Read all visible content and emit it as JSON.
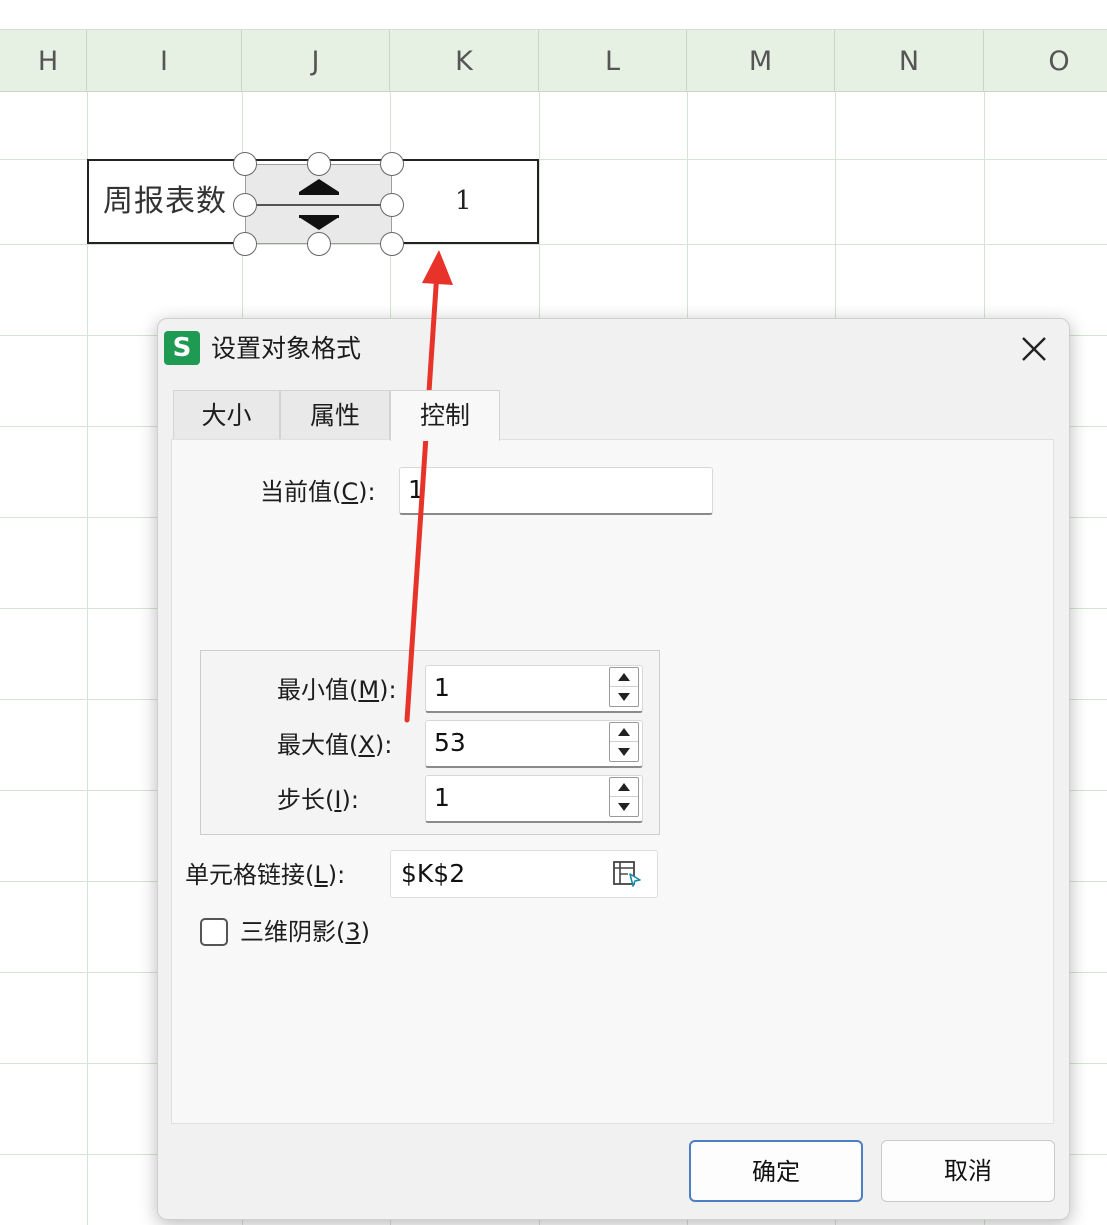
{
  "sheet": {
    "columns": [
      "H",
      "I",
      "J",
      "K",
      "L",
      "M",
      "N",
      "O"
    ],
    "label_cell": "周报表数",
    "value_cell": "1"
  },
  "dialog": {
    "app_icon": "S",
    "title": "设置对象格式",
    "tabs": [
      "大小",
      "属性",
      "控制"
    ],
    "active_tab": "控制",
    "current_value": {
      "label_pre": "当前值(",
      "key": "C",
      "label_post": "):",
      "value": "1"
    },
    "min_value": {
      "label_pre": "最小值(",
      "key": "M",
      "label_post": "):",
      "value": "1"
    },
    "max_value": {
      "label_pre": "最大值(",
      "key": "X",
      "label_post": "):",
      "value": "53"
    },
    "step": {
      "label_pre": "步长(",
      "key": "I",
      "label_post": "):",
      "value": "1"
    },
    "cell_link": {
      "label_pre": "单元格链接(",
      "key": "L",
      "label_post": "):",
      "value": "$K$2"
    },
    "shadow_3d": {
      "label_pre": "三维阴影(",
      "key": "3",
      "label_post": ")",
      "checked": false
    },
    "ok_label": "确定",
    "cancel_label": "取消"
  },
  "colors": {
    "header_bg": "#e6f1e4",
    "app_icon_green": "#1e9a52",
    "annotation_arrow": "#e8332a",
    "ok_border": "#4d7fc4"
  },
  "icons": [
    "close-icon",
    "range-picker-icon",
    "spin-up-icon",
    "spin-down-icon"
  ]
}
